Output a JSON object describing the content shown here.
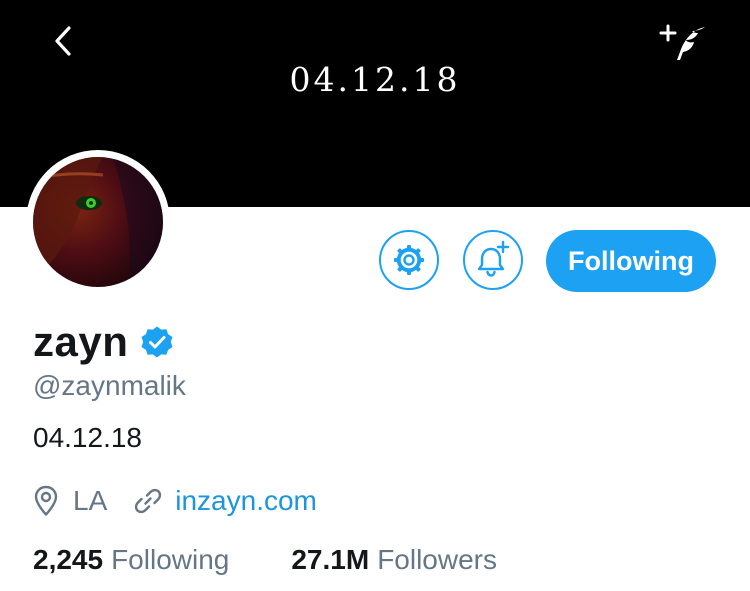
{
  "header": {
    "banner_text": "04.12.18",
    "back_icon": "chevron-left-icon",
    "compose_icon": "compose-tweet-icon"
  },
  "profile": {
    "display_name": "zayn",
    "verified": true,
    "handle": "@zaynmalik",
    "bio": "04.12.18",
    "location": "LA",
    "website": "inzayn.com"
  },
  "actions": {
    "settings_icon": "gear-icon",
    "notify_icon": "bell-plus-icon",
    "follow_label": "Following"
  },
  "stats": {
    "following_count": "2,245",
    "following_label": "Following",
    "followers_count": "27.1M",
    "followers_label": "Followers"
  },
  "colors": {
    "accent": "#1DA1F2",
    "link": "#1B95E0",
    "secondary_text": "#657786",
    "primary_text": "#14171a",
    "header_bg": "#000000"
  }
}
